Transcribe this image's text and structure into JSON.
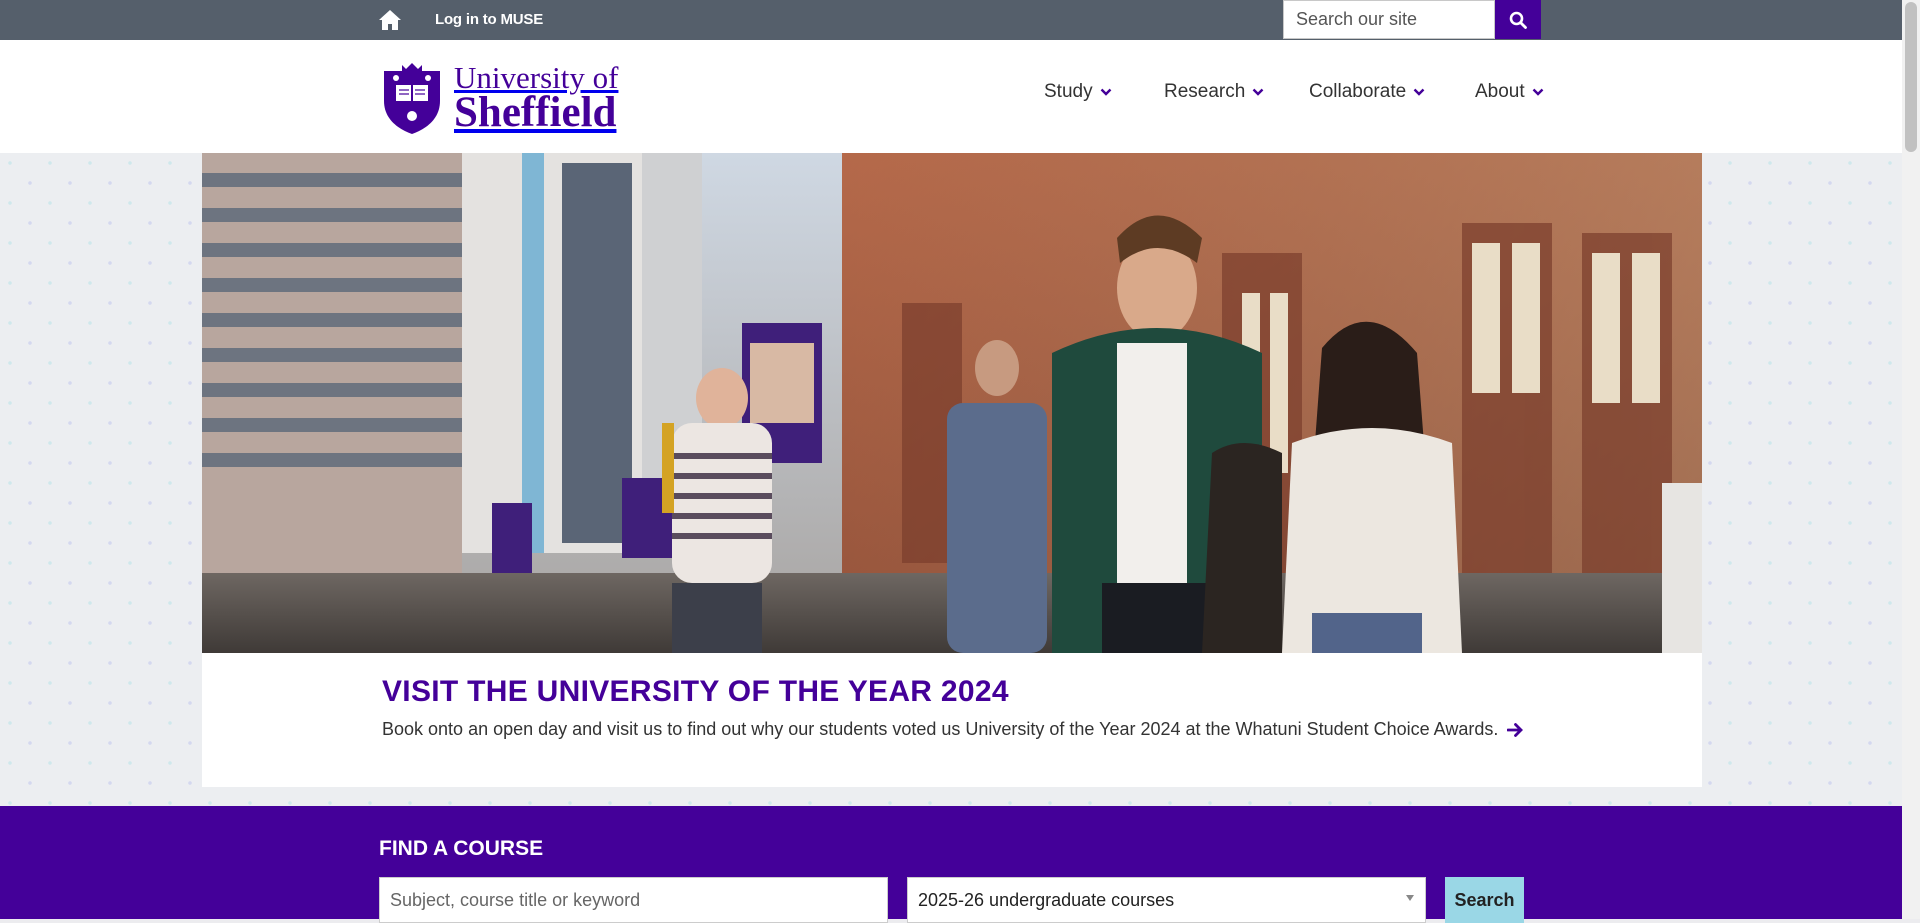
{
  "topbar": {
    "login_label": "Log in to MUSE",
    "search_placeholder": "Search our site"
  },
  "logo": {
    "line1": "University of",
    "line2": "Sheffield"
  },
  "nav": {
    "items": [
      {
        "label": "Study"
      },
      {
        "label": "Research"
      },
      {
        "label": "Collaborate"
      },
      {
        "label": "About"
      }
    ]
  },
  "hero": {
    "title": "VISIT THE UNIVERSITY OF THE YEAR 2024",
    "description": "Book onto an open day and visit us to find out why our students voted us University of the Year 2024 at the Whatuni Student Choice Awards."
  },
  "course_finder": {
    "title": "FIND A COURSE",
    "input_placeholder": "Subject, course title or keyword",
    "selected_course_type": "2025-26 undergraduate courses",
    "search_label": "Search"
  },
  "colors": {
    "brand_purple": "#440099",
    "topbar_grey": "#555f6b",
    "search_accent": "#9ad7e6"
  },
  "icons": {
    "home": "home-icon",
    "search": "search-icon",
    "chevron": "chevron-down-icon",
    "arrow": "arrow-right-icon"
  }
}
